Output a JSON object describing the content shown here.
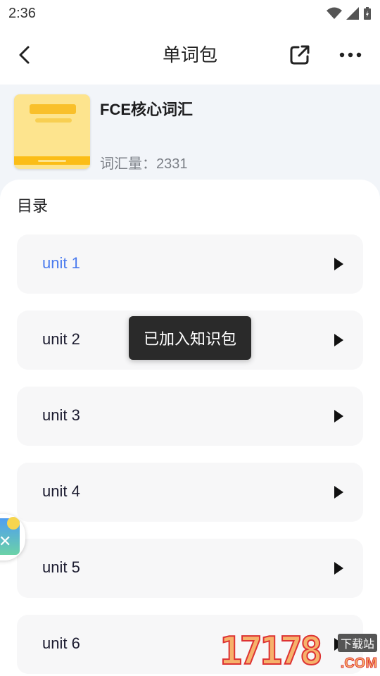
{
  "status_bar": {
    "time": "2:36"
  },
  "app_bar": {
    "title": "单词包"
  },
  "book": {
    "title": "FCE核心词汇",
    "vocab_count": "词汇量：2331"
  },
  "catalog": {
    "title": "目录",
    "units": [
      {
        "label": "unit 1",
        "active": true
      },
      {
        "label": "unit 2"
      },
      {
        "label": "unit 3"
      },
      {
        "label": "unit 4"
      },
      {
        "label": "unit 5"
      },
      {
        "label": "unit 6"
      }
    ]
  },
  "toast": {
    "message": "已加入知识包"
  },
  "watermark": {
    "number": "17178",
    "site": "下载站",
    "suffix": ".COM"
  },
  "colors": {
    "active_unit": "#4b7bee",
    "toast_bg": "#2a2a2a",
    "cover": "#fde48e"
  }
}
